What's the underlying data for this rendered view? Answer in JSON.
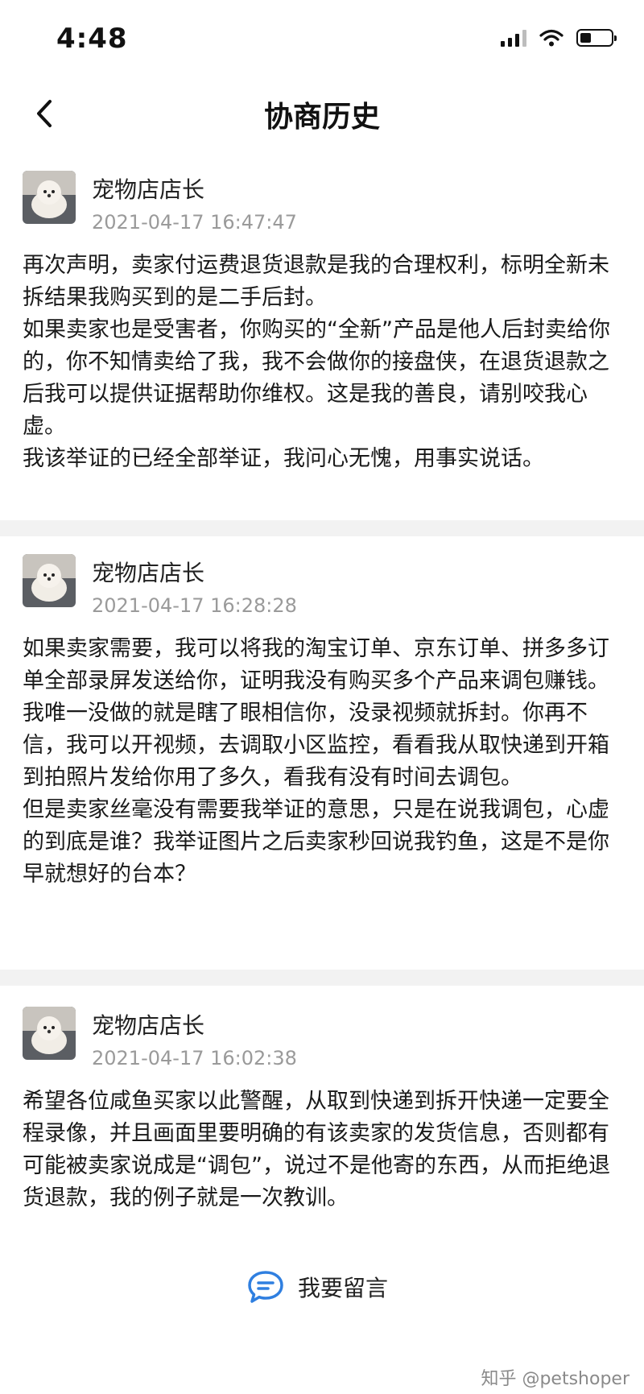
{
  "status_bar": {
    "time": "4:48",
    "battery_level": 0.35
  },
  "header": {
    "title": "协商历史"
  },
  "messages": [
    {
      "name": "宠物店店长",
      "time": "2021-04-17 16:47:47",
      "content": "再次声明，卖家付运费退货退款是我的合理权利，标明全新未拆结果我购买到的是二手后封。\n如果卖家也是受害者，你购买的“全新”产品是他人后封卖给你的，你不知情卖给了我，我不会做你的接盘侠，在退货退款之后我可以提供证据帮助你维权。这是我的善良，请别咬我心虚。\n我该举证的已经全部举证，我问心无愧，用事实说话。"
    },
    {
      "name": "宠物店店长",
      "time": "2021-04-17 16:28:28",
      "content": "如果卖家需要，我可以将我的淘宝订单、京东订单、拼多多订单全部录屏发送给你，证明我没有购买多个产品来调包赚钱。我唯一没做的就是瞎了眼相信你，没录视频就拆封。你再不信，我可以开视频，去调取小区监控，看看我从取快递到开箱到拍照片发给你用了多久，看我有没有时间去调包。\n但是卖家丝毫没有需要我举证的意思，只是在说我调包，心虚的到底是谁？我举证图片之后卖家秒回说我钓鱼，这是不是你早就想好的台本？"
    },
    {
      "name": "宠物店店长",
      "time": "2021-04-17 16:02:38",
      "content": "希望各位咸鱼买家以此警醒，从取到快递到拆开快递一定要全程录像，并且画面里要明确的有该卖家的发货信息，否则都有可能被卖家说成是“调包”，说过不是他寄的东西，从而拒绝退货退款，我的例子就是一次教训。"
    }
  ],
  "footer": {
    "reply_label": "我要留言"
  },
  "watermark": "知乎 @petshoper",
  "colors": {
    "accent": "#2f7fe0",
    "divider": "#f2f2f2",
    "timestamp": "#9a9a9a"
  }
}
